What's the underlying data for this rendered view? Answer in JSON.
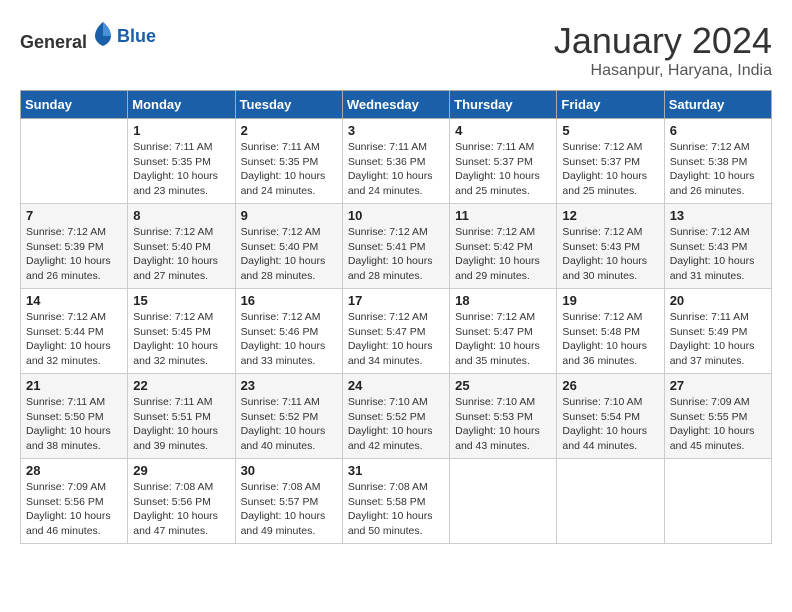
{
  "header": {
    "logo_general": "General",
    "logo_blue": "Blue",
    "month": "January 2024",
    "location": "Hasanpur, Haryana, India"
  },
  "weekdays": [
    "Sunday",
    "Monday",
    "Tuesday",
    "Wednesday",
    "Thursday",
    "Friday",
    "Saturday"
  ],
  "weeks": [
    [
      {
        "day": "",
        "info": ""
      },
      {
        "day": "1",
        "info": "Sunrise: 7:11 AM\nSunset: 5:35 PM\nDaylight: 10 hours\nand 23 minutes."
      },
      {
        "day": "2",
        "info": "Sunrise: 7:11 AM\nSunset: 5:35 PM\nDaylight: 10 hours\nand 24 minutes."
      },
      {
        "day": "3",
        "info": "Sunrise: 7:11 AM\nSunset: 5:36 PM\nDaylight: 10 hours\nand 24 minutes."
      },
      {
        "day": "4",
        "info": "Sunrise: 7:11 AM\nSunset: 5:37 PM\nDaylight: 10 hours\nand 25 minutes."
      },
      {
        "day": "5",
        "info": "Sunrise: 7:12 AM\nSunset: 5:37 PM\nDaylight: 10 hours\nand 25 minutes."
      },
      {
        "day": "6",
        "info": "Sunrise: 7:12 AM\nSunset: 5:38 PM\nDaylight: 10 hours\nand 26 minutes."
      }
    ],
    [
      {
        "day": "7",
        "info": "Sunrise: 7:12 AM\nSunset: 5:39 PM\nDaylight: 10 hours\nand 26 minutes."
      },
      {
        "day": "8",
        "info": "Sunrise: 7:12 AM\nSunset: 5:40 PM\nDaylight: 10 hours\nand 27 minutes."
      },
      {
        "day": "9",
        "info": "Sunrise: 7:12 AM\nSunset: 5:40 PM\nDaylight: 10 hours\nand 28 minutes."
      },
      {
        "day": "10",
        "info": "Sunrise: 7:12 AM\nSunset: 5:41 PM\nDaylight: 10 hours\nand 28 minutes."
      },
      {
        "day": "11",
        "info": "Sunrise: 7:12 AM\nSunset: 5:42 PM\nDaylight: 10 hours\nand 29 minutes."
      },
      {
        "day": "12",
        "info": "Sunrise: 7:12 AM\nSunset: 5:43 PM\nDaylight: 10 hours\nand 30 minutes."
      },
      {
        "day": "13",
        "info": "Sunrise: 7:12 AM\nSunset: 5:43 PM\nDaylight: 10 hours\nand 31 minutes."
      }
    ],
    [
      {
        "day": "14",
        "info": "Sunrise: 7:12 AM\nSunset: 5:44 PM\nDaylight: 10 hours\nand 32 minutes."
      },
      {
        "day": "15",
        "info": "Sunrise: 7:12 AM\nSunset: 5:45 PM\nDaylight: 10 hours\nand 32 minutes."
      },
      {
        "day": "16",
        "info": "Sunrise: 7:12 AM\nSunset: 5:46 PM\nDaylight: 10 hours\nand 33 minutes."
      },
      {
        "day": "17",
        "info": "Sunrise: 7:12 AM\nSunset: 5:47 PM\nDaylight: 10 hours\nand 34 minutes."
      },
      {
        "day": "18",
        "info": "Sunrise: 7:12 AM\nSunset: 5:47 PM\nDaylight: 10 hours\nand 35 minutes."
      },
      {
        "day": "19",
        "info": "Sunrise: 7:12 AM\nSunset: 5:48 PM\nDaylight: 10 hours\nand 36 minutes."
      },
      {
        "day": "20",
        "info": "Sunrise: 7:11 AM\nSunset: 5:49 PM\nDaylight: 10 hours\nand 37 minutes."
      }
    ],
    [
      {
        "day": "21",
        "info": "Sunrise: 7:11 AM\nSunset: 5:50 PM\nDaylight: 10 hours\nand 38 minutes."
      },
      {
        "day": "22",
        "info": "Sunrise: 7:11 AM\nSunset: 5:51 PM\nDaylight: 10 hours\nand 39 minutes."
      },
      {
        "day": "23",
        "info": "Sunrise: 7:11 AM\nSunset: 5:52 PM\nDaylight: 10 hours\nand 40 minutes."
      },
      {
        "day": "24",
        "info": "Sunrise: 7:10 AM\nSunset: 5:52 PM\nDaylight: 10 hours\nand 42 minutes."
      },
      {
        "day": "25",
        "info": "Sunrise: 7:10 AM\nSunset: 5:53 PM\nDaylight: 10 hours\nand 43 minutes."
      },
      {
        "day": "26",
        "info": "Sunrise: 7:10 AM\nSunset: 5:54 PM\nDaylight: 10 hours\nand 44 minutes."
      },
      {
        "day": "27",
        "info": "Sunrise: 7:09 AM\nSunset: 5:55 PM\nDaylight: 10 hours\nand 45 minutes."
      }
    ],
    [
      {
        "day": "28",
        "info": "Sunrise: 7:09 AM\nSunset: 5:56 PM\nDaylight: 10 hours\nand 46 minutes."
      },
      {
        "day": "29",
        "info": "Sunrise: 7:08 AM\nSunset: 5:56 PM\nDaylight: 10 hours\nand 47 minutes."
      },
      {
        "day": "30",
        "info": "Sunrise: 7:08 AM\nSunset: 5:57 PM\nDaylight: 10 hours\nand 49 minutes."
      },
      {
        "day": "31",
        "info": "Sunrise: 7:08 AM\nSunset: 5:58 PM\nDaylight: 10 hours\nand 50 minutes."
      },
      {
        "day": "",
        "info": ""
      },
      {
        "day": "",
        "info": ""
      },
      {
        "day": "",
        "info": ""
      }
    ]
  ]
}
